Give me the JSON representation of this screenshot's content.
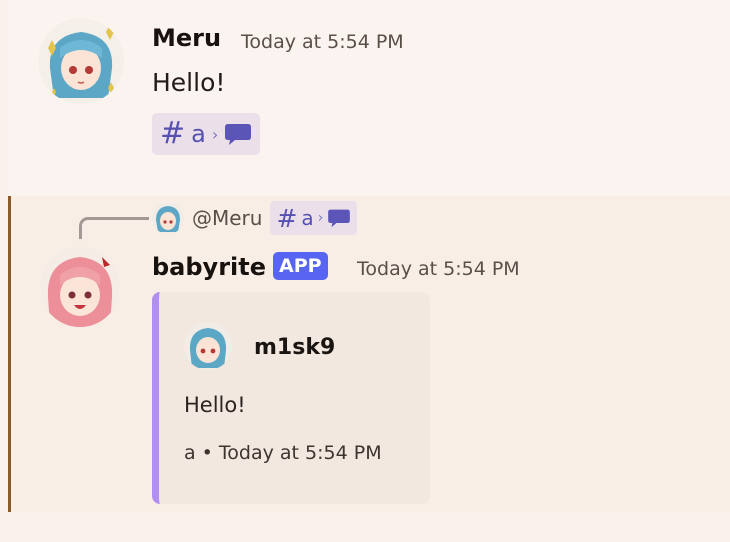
{
  "messages": [
    {
      "author": "Meru",
      "timestamp": "Today at 5:54 PM",
      "content": "Hello!",
      "channel_chip": {
        "name": "a"
      }
    },
    {
      "reply_to": {
        "author": "@Meru",
        "channel_chip": {
          "name": "a"
        }
      },
      "author": "babyrite",
      "badge": "APP",
      "timestamp": "Today at 5:54 PM",
      "embed": {
        "author": "m1sk9",
        "description": "Hello!",
        "footer": "a • Today at 5:54 PM",
        "accent_color": "#b18ef2"
      }
    }
  ],
  "icons": {
    "hash": "#",
    "chevron": "›"
  },
  "colors": {
    "mention_chip_bg": "#ebe0ea",
    "mention_chip_fg": "#5651b0",
    "app_badge": "#5865f2",
    "highlight_bar": "#8a5a2b"
  }
}
